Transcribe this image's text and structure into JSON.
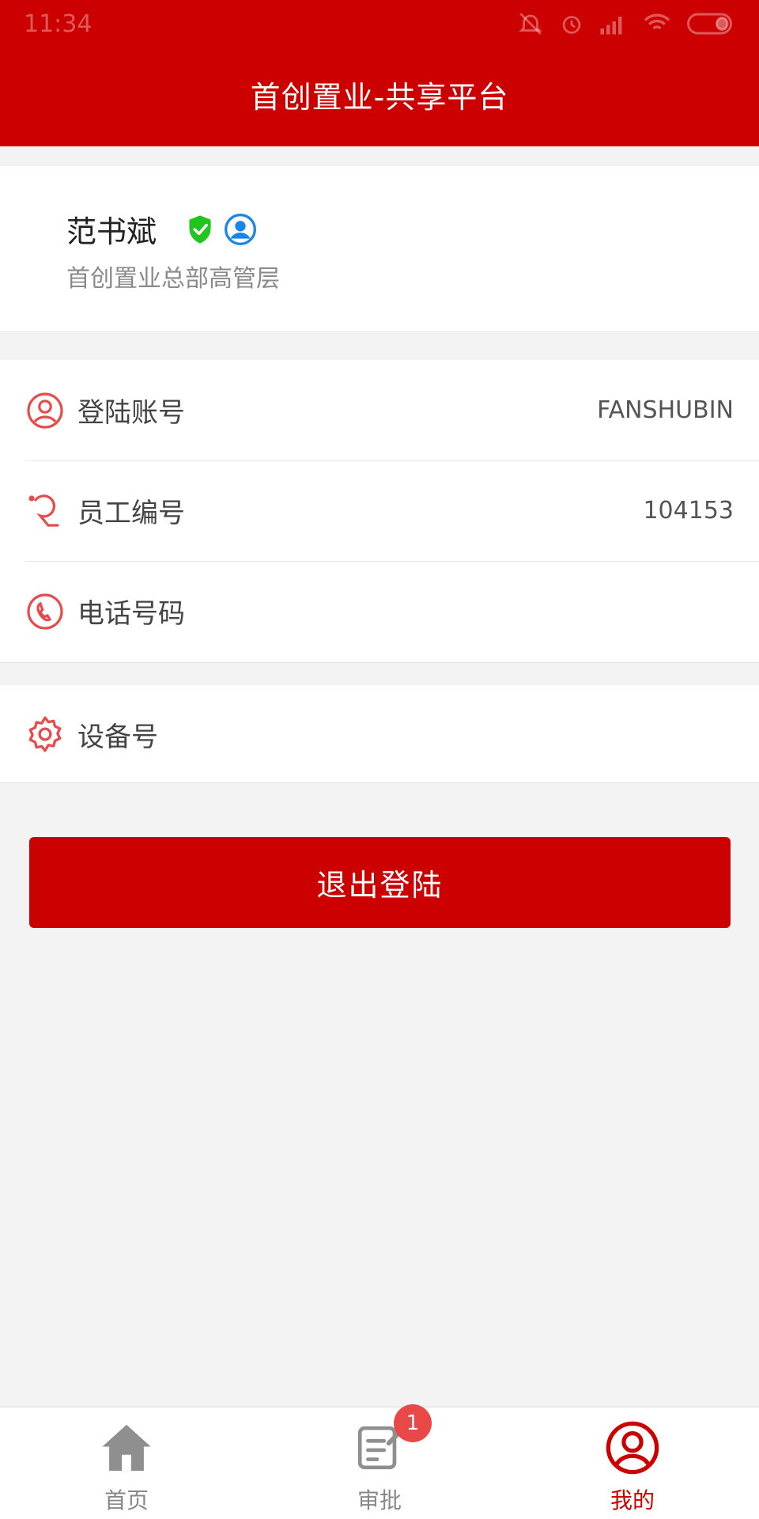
{
  "status_bar": {
    "time": "11:34"
  },
  "header": {
    "title": "首创置业-共享平台"
  },
  "profile": {
    "name": "范书斌",
    "department": "首创置业总部高管层"
  },
  "info_list": [
    {
      "label": "登陆账号",
      "value": "FANSHUBIN",
      "icon": "user-circle-icon"
    },
    {
      "label": "员工编号",
      "value": "104153",
      "icon": "employee-id-icon"
    },
    {
      "label": "电话号码",
      "value": "",
      "icon": "phone-icon"
    }
  ],
  "device": {
    "label": "设备号",
    "value": "",
    "icon": "gear-icon"
  },
  "logout_button": {
    "label": "退出登陆"
  },
  "tabs": [
    {
      "label": "首页",
      "icon": "home-icon",
      "active": false
    },
    {
      "label": "审批",
      "icon": "approval-icon",
      "active": false,
      "badge": "1"
    },
    {
      "label": "我的",
      "icon": "profile-icon",
      "active": true
    }
  ],
  "colors": {
    "primary": "#cc0000",
    "icon_red": "#e84b4b",
    "shield_green": "#22c41e",
    "user_blue": "#1a86e8",
    "inactive_tab": "#888888"
  }
}
